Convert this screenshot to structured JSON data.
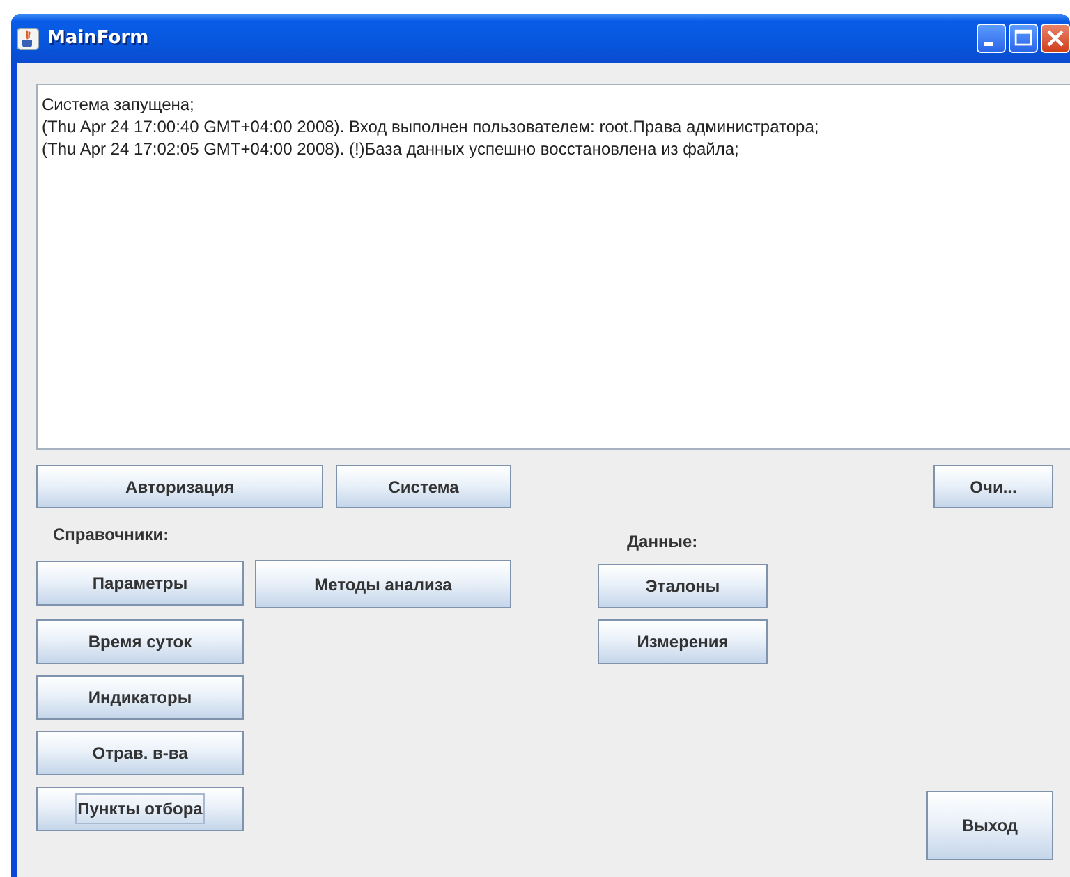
{
  "window": {
    "title": "MainForm"
  },
  "log": {
    "lines": [
      "Система запущена;",
      "(Thu Apr 24 17:00:40 GMT+04:00 2008). Вход выполнен пользователем:  root.Права администратора;",
      "(Thu Apr 24 17:02:05 GMT+04:00 2008). (!)База данных успешно восстановлена из файла;"
    ]
  },
  "toolbar": {
    "buttons": [
      {
        "label": "Авторизация",
        "focused": false
      },
      {
        "label": "Система",
        "focused": false
      },
      {
        "label": "Очи...",
        "focused": false
      }
    ]
  },
  "reference_section": {
    "label": "Справочники:",
    "buttons": [
      {
        "label": "Параметры",
        "focused": false
      },
      {
        "label": "Методы анализа",
        "focused": false
      },
      {
        "label": "Время суток",
        "focused": false
      },
      {
        "label": "Индикаторы",
        "focused": false
      },
      {
        "label": "Отрав. в-ва",
        "focused": false
      },
      {
        "label": "Пункты отбора",
        "focused": true
      }
    ]
  },
  "data_section": {
    "label": "Данные:",
    "buttons": [
      {
        "label": "Эталоны",
        "focused": false
      },
      {
        "label": "Измерения",
        "focused": false
      }
    ]
  },
  "exit_button": {
    "label": "Выход",
    "focused": false
  }
}
